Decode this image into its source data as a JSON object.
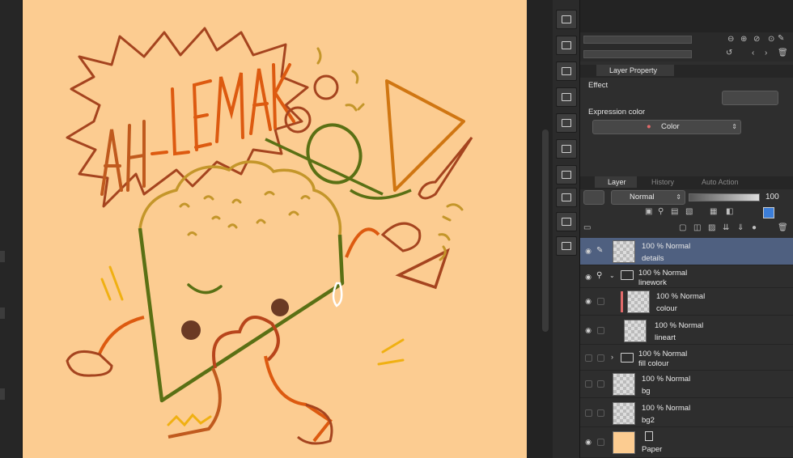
{
  "canvas": {
    "background": "#fccc91",
    "artwork_text": "AH-LEMAK"
  },
  "toolstrip": {
    "icons": [
      "layer-copy-icon",
      "layer-copy-icon",
      "close-icon",
      "grid-icon",
      "layer-copy-icon",
      "transform-icon",
      "layer-copy-icon",
      "grid-icon",
      "layer-copy-icon",
      "export-icon"
    ]
  },
  "layer_property": {
    "tab_label": "Layer Property",
    "effect_label": "Effect",
    "expression_color_label": "Expression color",
    "expression_color_value": "Color"
  },
  "layer_panel": {
    "tabs": [
      "Layer",
      "History",
      "Auto Action"
    ],
    "blend_mode": "Normal",
    "opacity": "100",
    "layers": [
      {
        "opacity_mode": "100 % Normal",
        "name": "details",
        "selected": true,
        "type": "raster",
        "visible": true
      },
      {
        "opacity_mode": "100 % Normal",
        "name": "linework",
        "selected": false,
        "type": "folder-open",
        "visible": true
      },
      {
        "opacity_mode": "100 % Normal",
        "name": "colour",
        "selected": false,
        "type": "raster",
        "visible": true,
        "indent": true
      },
      {
        "opacity_mode": "100 % Normal",
        "name": "lineart",
        "selected": false,
        "type": "raster",
        "visible": true,
        "indent": true
      },
      {
        "opacity_mode": "100 % Normal",
        "name": "fill colour",
        "selected": false,
        "type": "folder-closed",
        "visible": false
      },
      {
        "opacity_mode": "100 % Normal",
        "name": "bg",
        "selected": false,
        "type": "raster",
        "visible": false
      },
      {
        "opacity_mode": "100 % Normal",
        "name": "bg2",
        "selected": false,
        "type": "raster",
        "visible": false
      },
      {
        "opacity_mode": "",
        "name": "Paper",
        "selected": false,
        "type": "paper",
        "visible": true
      }
    ]
  },
  "colors": {
    "selection": "#4f6080",
    "accent_red": "#e06a6a",
    "paper": "#fccc91"
  }
}
